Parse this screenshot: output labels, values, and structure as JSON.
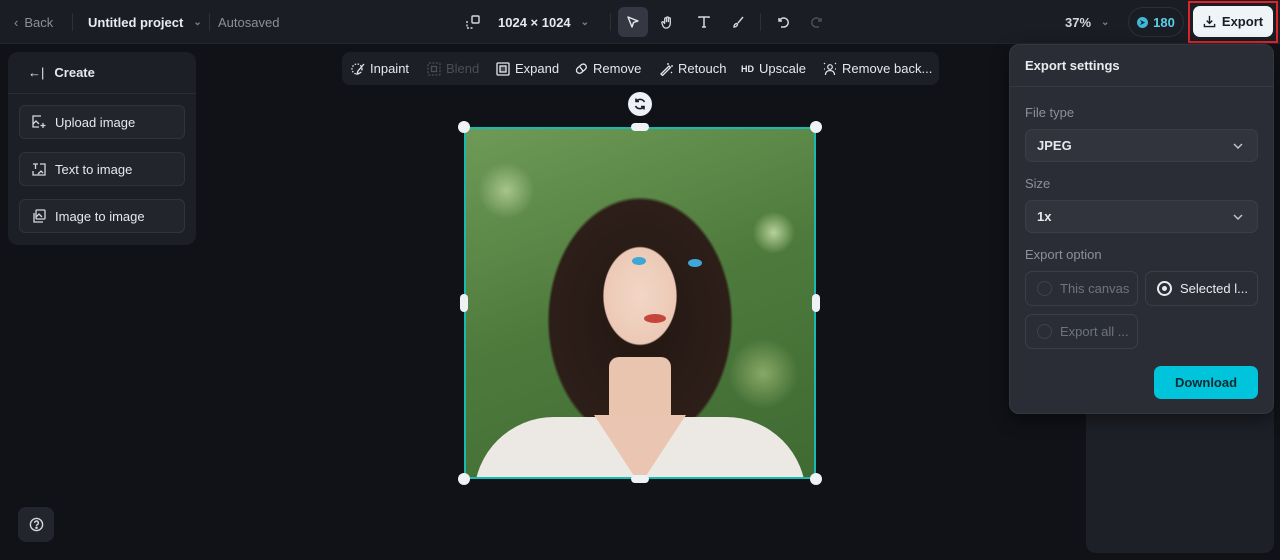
{
  "topbar": {
    "back_label": "Back",
    "project_name": "Untitled project",
    "save_status": "Autosaved",
    "canvas_size": "1024 × 1024",
    "tools": [
      {
        "name": "resize-icon",
        "active": false
      },
      {
        "name": "select-pointer-icon",
        "active": true
      },
      {
        "name": "hand-pan-icon",
        "active": false
      },
      {
        "name": "text-tool-icon",
        "active": false
      },
      {
        "name": "brush-icon",
        "active": false
      },
      {
        "name": "undo-icon",
        "active": false
      },
      {
        "name": "redo-icon",
        "active": false,
        "disabled": true
      }
    ],
    "zoom_level": "37%",
    "credits": "180",
    "export_label": "Export"
  },
  "left_panel": {
    "header": "Create",
    "items": [
      {
        "label": "Upload image",
        "icon": "upload-image-icon"
      },
      {
        "label": "Text to image",
        "icon": "text-to-image-icon"
      },
      {
        "label": "Image to image",
        "icon": "image-to-image-icon"
      }
    ]
  },
  "edit_toolbar": {
    "items": [
      {
        "label": "Inpaint",
        "icon": "inpaint-icon",
        "disabled": false
      },
      {
        "label": "Blend",
        "icon": "blend-icon",
        "disabled": true
      },
      {
        "label": "Expand",
        "icon": "expand-icon",
        "disabled": false
      },
      {
        "label": "Remove",
        "icon": "eraser-icon",
        "disabled": false
      },
      {
        "label": "Retouch",
        "icon": "retouch-wand-icon",
        "disabled": false
      },
      {
        "label": "Upscale",
        "icon": "hd-icon",
        "icon_text": "HD",
        "disabled": false
      },
      {
        "label": "Remove back...",
        "icon": "remove-background-icon",
        "disabled": false
      }
    ]
  },
  "canvas": {
    "image_description": "Portrait of a young woman with dark hair and blue eyes, white lace blouse, green bokeh background",
    "selection_color": "#19b8b0"
  },
  "export_settings": {
    "title": "Export settings",
    "file_type_label": "File type",
    "file_type_value": "JPEG",
    "size_label": "Size",
    "size_value": "1x",
    "export_option_label": "Export option",
    "options": [
      {
        "label": "This canvas",
        "selected": false
      },
      {
        "label": "Selected l...",
        "selected": true
      },
      {
        "label": "Export all ...",
        "selected": false
      }
    ],
    "download_label": "Download",
    "accent_color": "#00c4dc"
  },
  "highlight_color": "#e0232b"
}
